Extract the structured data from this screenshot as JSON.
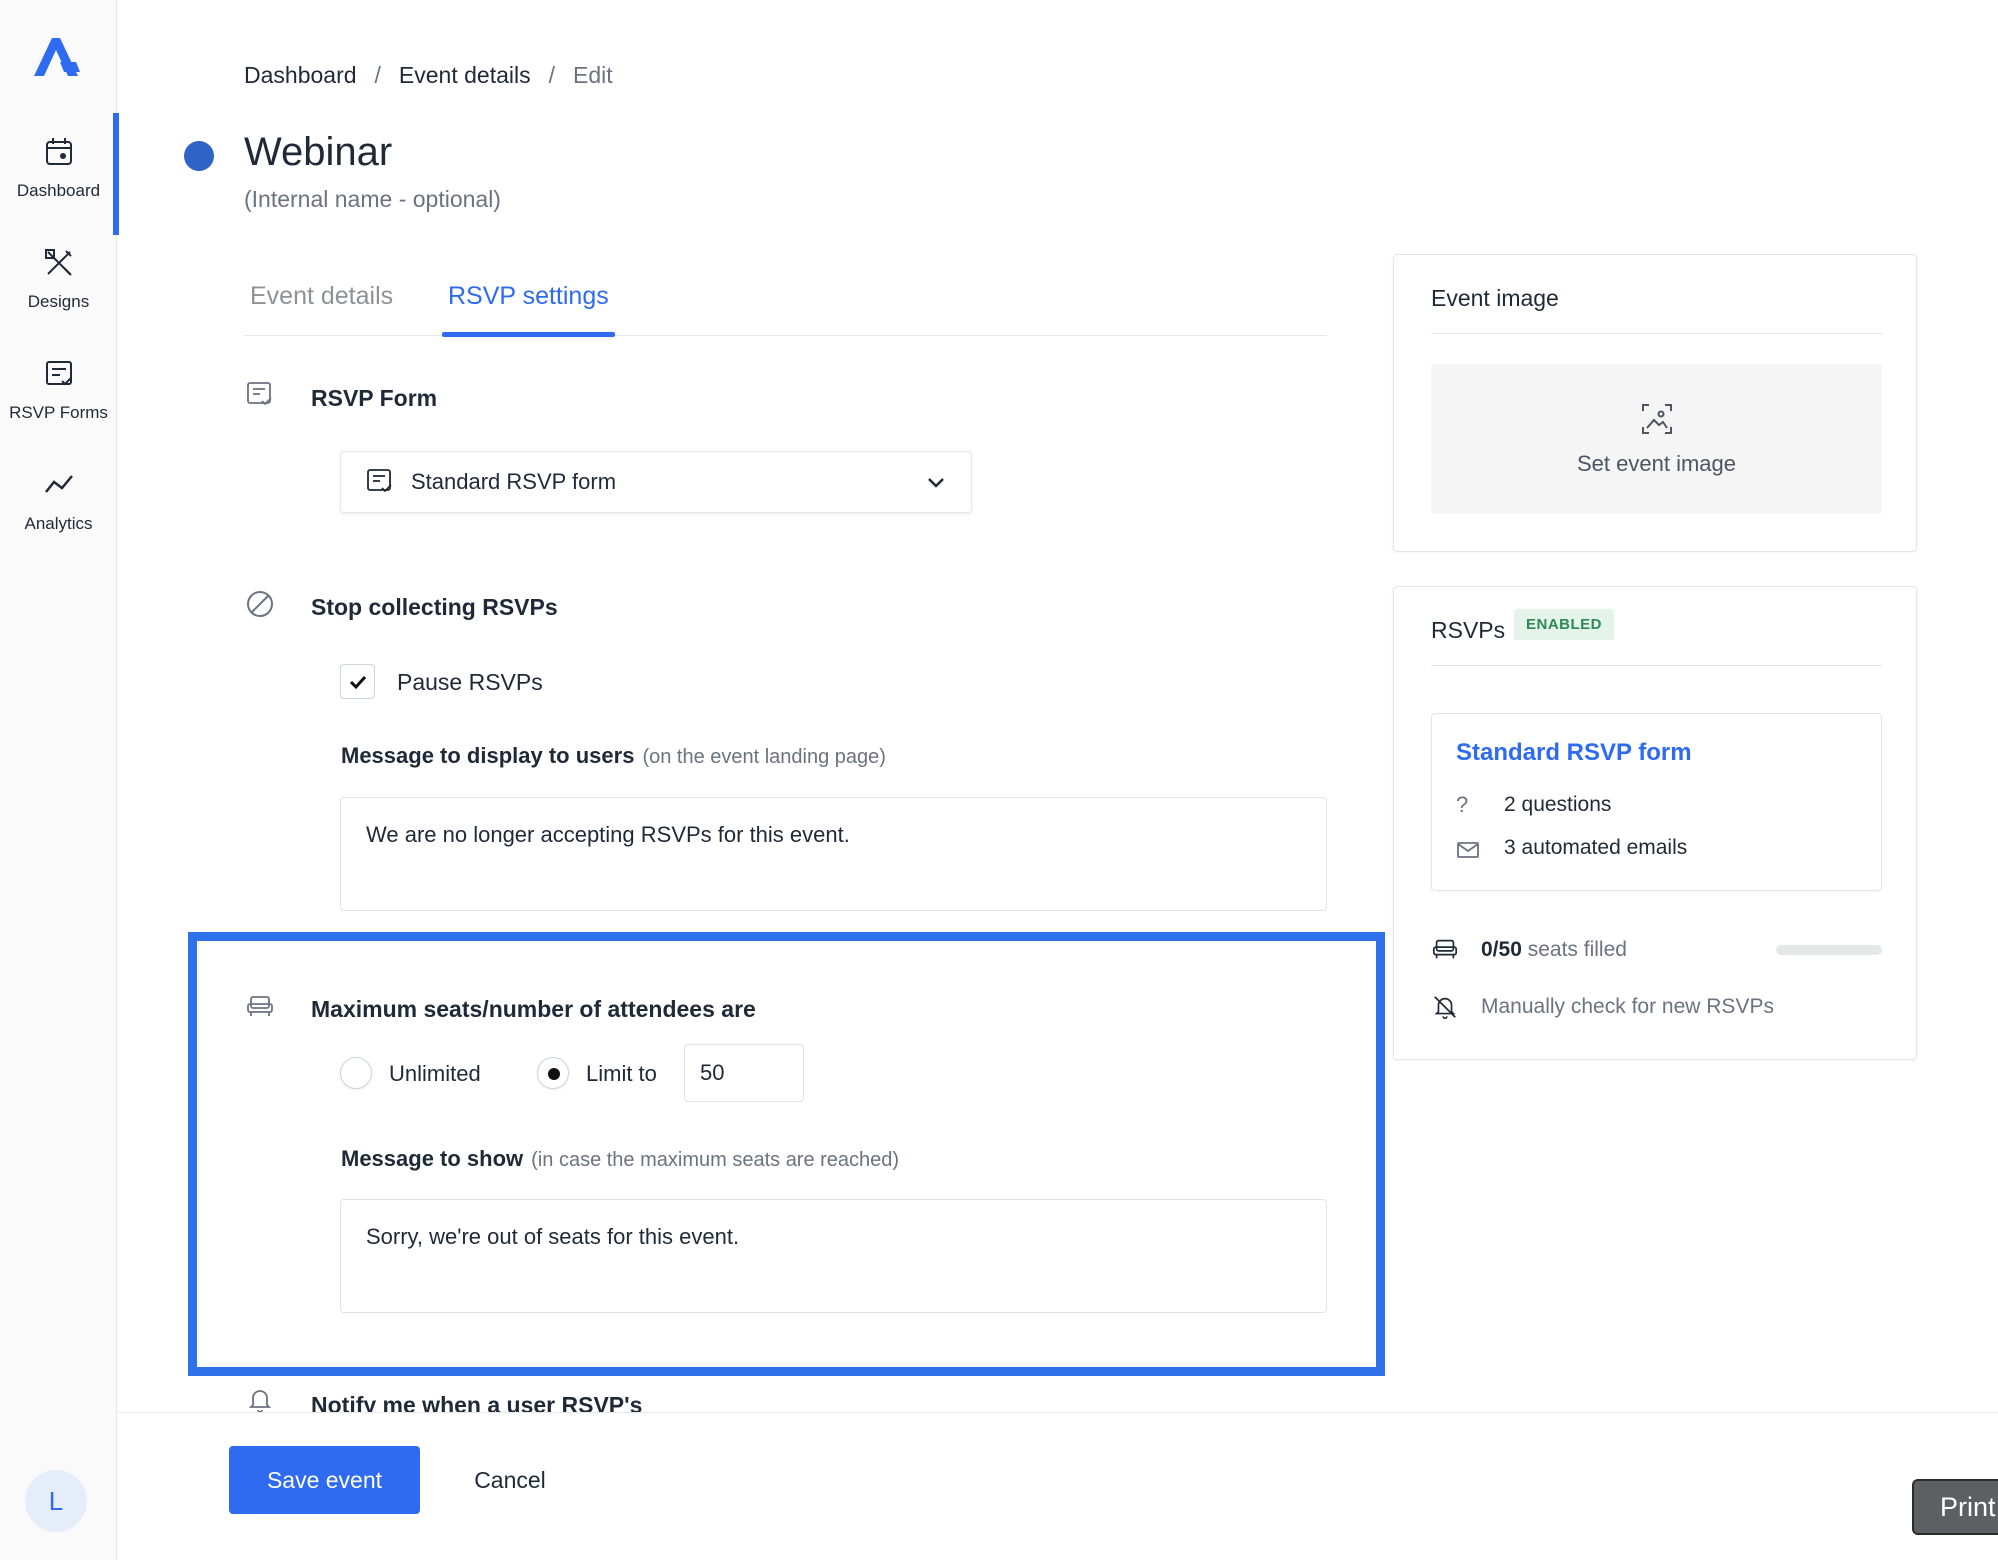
{
  "sidebar": {
    "items": [
      {
        "label": "Dashboard",
        "icon": "calendar-icon"
      },
      {
        "label": "Designs",
        "icon": "design-tools-icon"
      },
      {
        "label": "RSVP Forms",
        "icon": "form-icon"
      },
      {
        "label": "Analytics",
        "icon": "analytics-icon"
      }
    ],
    "avatar_initial": "L"
  },
  "breadcrumb": {
    "items": [
      "Dashboard",
      "Event details",
      "Edit"
    ],
    "separator": "/"
  },
  "event": {
    "title": "Webinar",
    "internal_name_placeholder": "(Internal name - optional)",
    "color": "#2f63c6"
  },
  "tabs": [
    {
      "label": "Event details"
    },
    {
      "label": "RSVP settings",
      "active": true
    }
  ],
  "rsvp_form": {
    "title": "RSVP Form",
    "selected": "Standard RSVP form"
  },
  "stop_collecting": {
    "title": "Stop collecting RSVPs",
    "pause_label": "Pause RSVPs",
    "pause_checked": true,
    "message_label": "Message to display to users",
    "message_hint": "(on the event landing page)",
    "message_value": "We are no longer accepting RSVPs for this event."
  },
  "max_seats": {
    "title": "Maximum seats/number of attendees are",
    "unlimited_label": "Unlimited",
    "limit_label": "Limit to",
    "limit_value": "50",
    "selected": "limit",
    "message_label": "Message to show",
    "message_hint": "(in case the maximum seats are reached)",
    "message_value": "Sorry, we're out of seats for this event."
  },
  "notify": {
    "title": "Notify me when a user RSVP's"
  },
  "actions": {
    "save_label": "Save event",
    "cancel_label": "Cancel",
    "print_label": "Print"
  },
  "event_image_panel": {
    "title": "Event image",
    "set_label": "Set event image"
  },
  "rsvps_panel": {
    "title": "RSVPs",
    "status_badge": "ENABLED",
    "form_name": "Standard RSVP form",
    "questions": "2 questions",
    "emails": "3 automated emails",
    "seats_count": "0/50",
    "seats_suffix": "seats filled",
    "seats_fill_fraction": 0,
    "manual_check": "Manually check for new RSVPs"
  },
  "colors": {
    "accent": "#2f6bf0",
    "highlight": "#2f71eb",
    "enabled_badge": "#2e8a55"
  }
}
